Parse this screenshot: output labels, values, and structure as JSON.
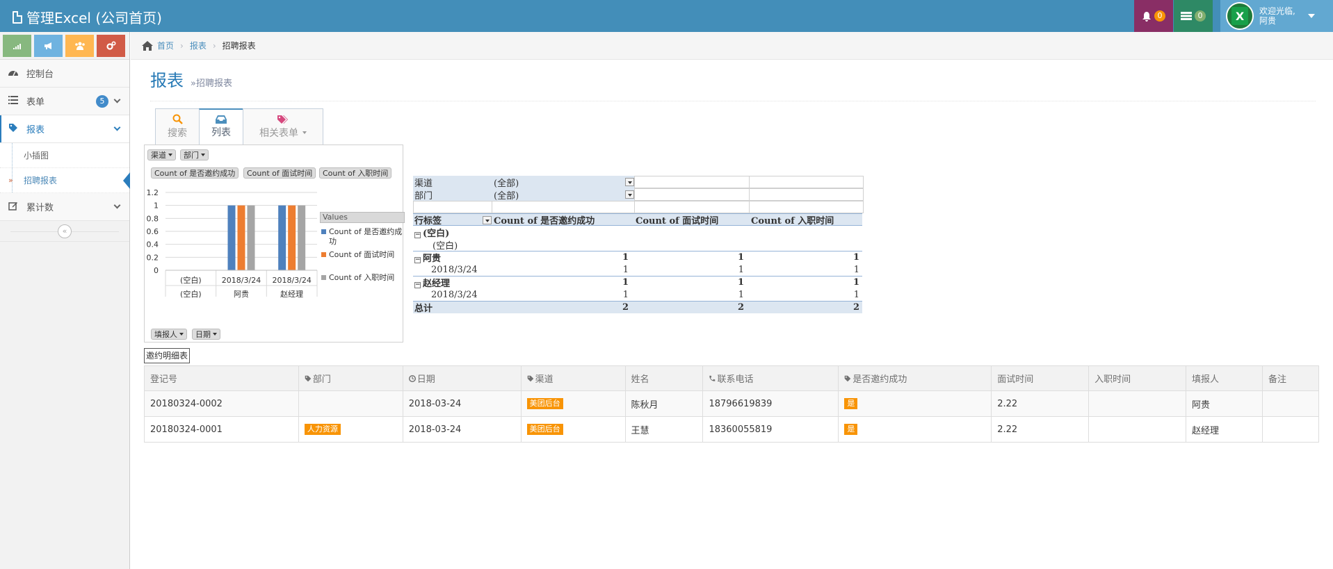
{
  "navbar": {
    "title": "管理Excel (公司首页)",
    "bell_count": "0",
    "task_count": "0",
    "user_greeting": "欢迎光临,",
    "user_name": "阿贵",
    "avatar_letter": "X"
  },
  "sidebar": {
    "items": [
      {
        "label": "控制台",
        "icon": "dashboard-icon"
      },
      {
        "label": "表单",
        "icon": "list-icon",
        "badge": "5"
      },
      {
        "label": "报表",
        "icon": "tag-icon"
      },
      {
        "label": "累计数",
        "icon": "edit-icon"
      }
    ],
    "submenu": [
      "小插图",
      "招聘报表"
    ],
    "collapse_glyph": "«"
  },
  "breadcrumb": {
    "home": "首页",
    "level1": "报表",
    "current": "招聘报表"
  },
  "page": {
    "title": "报表",
    "subtitle": "»招聘报表"
  },
  "tabs": [
    {
      "label": "搜索",
      "icon": "search-icon"
    },
    {
      "label": "列表",
      "icon": "inbox-icon"
    },
    {
      "label": "相关表单",
      "icon": "tags-icon"
    }
  ],
  "pivot_chart": {
    "filter_fields": [
      "渠道",
      "部门"
    ],
    "value_fields": [
      "Count of 是否邀约成功",
      "Count of 面试时间",
      "Count of 入职时间"
    ],
    "axis_fields": [
      "填报人",
      "日期"
    ],
    "legend_title": "Values",
    "y_ticks": [
      "1.2",
      "1",
      "0.8",
      "0.6",
      "0.4",
      "0.2",
      "0"
    ],
    "x_groups": [
      {
        "sub": "(空白)",
        "main": "(空白)"
      },
      {
        "sub": "2018/3/24",
        "main": "阿贵"
      },
      {
        "sub": "2018/3/24",
        "main": "赵经理"
      }
    ]
  },
  "chart_data": {
    "type": "bar",
    "categories": [
      "(空白) (空白)",
      "阿贵 2018/3/24",
      "赵经理 2018/3/24"
    ],
    "series": [
      {
        "name": "Count of 是否邀约成功",
        "values": [
          0,
          1,
          1
        ],
        "color": "#4f81bd"
      },
      {
        "name": "Count of 面试时间",
        "values": [
          0,
          1,
          1
        ],
        "color": "#ed7d31"
      },
      {
        "name": "Count of 入职时间",
        "values": [
          0,
          1,
          1
        ],
        "color": "#a5a5a5"
      }
    ],
    "ylim": [
      0,
      1.2
    ],
    "title": "",
    "xlabel": "",
    "ylabel": ""
  },
  "pivot_table": {
    "filters": [
      {
        "name": "渠道",
        "value": "(全部)"
      },
      {
        "name": "部门",
        "value": "(全部)"
      }
    ],
    "row_label": "行标签",
    "columns": [
      "Count of 是否邀约成功",
      "Count of 面试时间",
      "Count of 入职时间"
    ],
    "rows": [
      {
        "label": "(空白)",
        "level": 0,
        "values": [
          "",
          "",
          ""
        ]
      },
      {
        "label": "(空白)",
        "level": 1,
        "values": [
          "",
          "",
          ""
        ]
      },
      {
        "label": "阿贵",
        "level": 0,
        "values": [
          "1",
          "1",
          "1"
        ]
      },
      {
        "label": "2018/3/24",
        "level": 1,
        "values": [
          "1",
          "1",
          "1"
        ]
      },
      {
        "label": "赵经理",
        "level": 0,
        "values": [
          "1",
          "1",
          "1"
        ]
      },
      {
        "label": "2018/3/24",
        "level": 1,
        "values": [
          "1",
          "1",
          "1"
        ]
      }
    ],
    "total": {
      "label": "总计",
      "values": [
        "2",
        "2",
        "2"
      ]
    }
  },
  "detail_label": "邀约明细表",
  "detail_table": {
    "headers": [
      {
        "label": "登记号",
        "icon": ""
      },
      {
        "label": "部门",
        "icon": "tag-icon"
      },
      {
        "label": "日期",
        "icon": "clock-icon"
      },
      {
        "label": "渠道",
        "icon": "tag-icon"
      },
      {
        "label": "姓名",
        "icon": ""
      },
      {
        "label": "联系电话",
        "icon": "phone-icon"
      },
      {
        "label": "是否邀约成功",
        "icon": "tag-icon"
      },
      {
        "label": "面试时间",
        "icon": ""
      },
      {
        "label": "入职时间",
        "icon": ""
      },
      {
        "label": "填报人",
        "icon": ""
      },
      {
        "label": "备注",
        "icon": ""
      }
    ],
    "rows": [
      [
        "20180324-0002",
        "",
        "2018-03-24",
        "美团后台",
        "陈秋月",
        "18796619839",
        "是",
        "2.22",
        "",
        "阿贵",
        ""
      ],
      [
        "20180324-0001",
        "人力资源",
        "2018-03-24",
        "美团后台",
        "王慧",
        "18360055819",
        "是",
        "2.22",
        "",
        "赵经理",
        ""
      ]
    ],
    "tag_color": "#f89406"
  }
}
